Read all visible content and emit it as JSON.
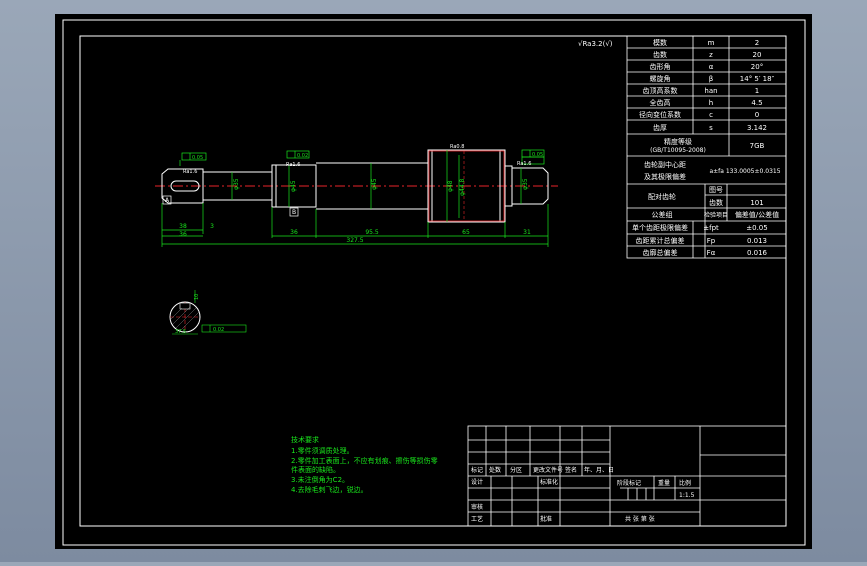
{
  "colors": {
    "frame": "#ffffff",
    "dimension": "#19e61c",
    "centerline": "#e8252a",
    "paper": "#000000",
    "surround": "#8795a8"
  },
  "params": {
    "rows": [
      {
        "name": "模数",
        "sym": "m",
        "val": "2"
      },
      {
        "name": "齿数",
        "sym": "z",
        "val": "20"
      },
      {
        "name": "齿形角",
        "sym": "α",
        "val": "20°"
      },
      {
        "name": "螺旋角",
        "sym": "β",
        "val": "14° 5′ 18″"
      },
      {
        "name": "齿顶高系数",
        "sym": "han",
        "val": "1"
      },
      {
        "name": "全齿高",
        "sym": "h",
        "val": "4.5"
      },
      {
        "name": "径向变位系数",
        "sym": "c",
        "val": "0"
      },
      {
        "name": "齿厚",
        "sym": "s",
        "val": "3.142"
      }
    ],
    "grade_name": "精度等级",
    "grade_std": "(GB/T10095-2008)",
    "grade_val": "7GB",
    "center_name_1": "齿轮副中心距",
    "center_name_2": "及其极限偏差",
    "center_val": "a±fa 133.0005±0.0315",
    "mate_name": "配对齿轮",
    "mate_fig": "图号",
    "mate_teeth": "齿数",
    "mate_teeth_val": "101",
    "group_name": "公差组",
    "group_col": "检验项目",
    "group_val": "偏差值/公差值",
    "extra_rows": [
      {
        "name": "单个齿距极限偏差",
        "sym": "±fpt",
        "val": "±0.05"
      },
      {
        "name": "齿距累计总偏差",
        "sym": "Fp",
        "val": "0.013"
      },
      {
        "name": "齿廓总偏差",
        "sym": "Fα",
        "val": "0.016"
      }
    ]
  },
  "roughness_note": "√Ra3.2(√)",
  "drawing": {
    "dims": {
      "d1": "38",
      "d2": "36",
      "d3": "36",
      "d4": "95.5",
      "d5": "65",
      "d6": "31",
      "total": "327.5",
      "small": "3",
      "phi1": "φ35",
      "phi2": "φ45",
      "phi3": "φ48",
      "phi4": "φ44.8",
      "phi5": "φ35"
    },
    "tol_boxes": [
      "0.05",
      "0.02",
      "0.05"
    ],
    "rough_labels": [
      "Ra1.6",
      "Ra1.6",
      "Ra0.8",
      "Ra1.6"
    ],
    "datum_labels": [
      "A",
      "B"
    ],
    "section": {
      "width_label": "10",
      "depth_label": "37.5",
      "tol": "0.02"
    }
  },
  "notes": {
    "title": "技术要求",
    "lines": [
      "1.零件须调质处理。",
      "2.零件加工表面上，不应有划痕、擦伤等损伤零",
      "件表面的缺陷。",
      "3.未注倒角为C2。",
      "4.去除毛刺飞边，锐边。"
    ]
  },
  "titleblock": {
    "r1": [
      "标记",
      "处数",
      "分区",
      "更改文件号",
      "签名",
      "年、月、日"
    ],
    "designer": "设计",
    "standard": "标准化",
    "stage": "阶段标记",
    "weight": "重量",
    "ratio": "比例",
    "ratio_val": "1:1.5",
    "reviewer": "审核",
    "craft": "工艺",
    "approve": "批准",
    "sheets": "共 张  第 张"
  }
}
